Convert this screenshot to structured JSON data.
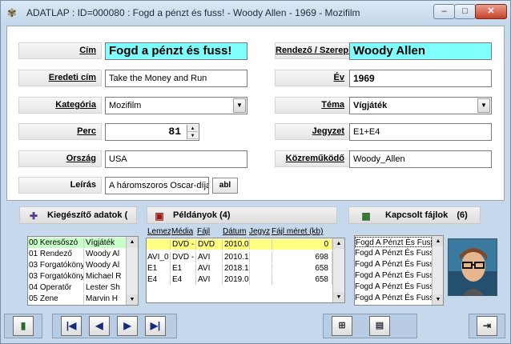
{
  "window": {
    "title": "ADATLAP : ID=000080 : Fogd a pénzt és fuss! - Woody Allen - 1969 - Mozifilm",
    "min_glyph": "–",
    "max_glyph": "□",
    "close_glyph": "✕"
  },
  "fields": {
    "cim": {
      "label": "Cím",
      "value": "Fogd a pénzt és fuss!"
    },
    "rendezo": {
      "label": "Rendező / Szereplő",
      "value": "Woody Allen"
    },
    "eredeti_cim": {
      "label": "Eredeti cím",
      "value": "Take the Money and Run"
    },
    "ev": {
      "label": "Év",
      "value": "1969"
    },
    "kategoria": {
      "label": "Kategória",
      "value": "Mozifilm"
    },
    "tema": {
      "label": "Téma",
      "value": "Vígjáték"
    },
    "perc": {
      "label": "Perc",
      "value": "81"
    },
    "jegyzet": {
      "label": "Jegyzet",
      "value": "E1+E4"
    },
    "orszag": {
      "label": "Ország",
      "value": "USA"
    },
    "kozremukodo": {
      "label": "Közreműködő",
      "value": "Woody_Allen"
    },
    "leiras": {
      "label": "Leírás",
      "value": "A háromszoros Oscar-díja",
      "abl_label": "abl"
    }
  },
  "kiegeszito": {
    "header": "Kiegészítő adatok (",
    "rows": [
      {
        "key": "00 Keresőszó",
        "value": "Vígjáték"
      },
      {
        "key": "01 Rendező",
        "value": "Woody Al"
      },
      {
        "key": "03 Forgatókönyv",
        "value": "Woody Al"
      },
      {
        "key": "03 Forgatókönyv",
        "value": "Michael R"
      },
      {
        "key": "04 Operatőr",
        "value": "Lester Sh"
      },
      {
        "key": "05 Zene",
        "value": "Marvin H"
      }
    ]
  },
  "peldanyok": {
    "header": "Példányok (4)",
    "columns": [
      "Lemez",
      "Média",
      "Fájl",
      "Dátum",
      "Jegyz",
      "Fájl méret (kb)"
    ],
    "rows": [
      {
        "lemez": "",
        "media": "DVD -",
        "fajl": "DVD",
        "datum": "2010.0",
        "jegyz": "",
        "meret": "0"
      },
      {
        "lemez": "AVI_0",
        "media": "DVD -",
        "fajl": "AVI",
        "datum": "2010.1",
        "jegyz": "",
        "meret": "698"
      },
      {
        "lemez": "E1",
        "media": "E1",
        "fajl": "AVI",
        "datum": "2018.1",
        "jegyz": "",
        "meret": "658"
      },
      {
        "lemez": "E4",
        "media": "E4",
        "fajl": "AVI",
        "datum": "2019.0",
        "jegyz": "",
        "meret": "658"
      }
    ]
  },
  "kapcsolt": {
    "header": "Kapcsolt fájlok",
    "count": "(6)",
    "rows": [
      "Fogd A Pénzt És Fuss",
      "Fogd A Pénzt És Fuss",
      "Fogd A Pénzt És Fuss",
      "Fogd A Pénzt És Fuss",
      "Fogd A Pénzt És Fuss",
      "Fogd A Pénzt És Fuss"
    ]
  },
  "icons": {
    "app": "film-reel-icon",
    "kiegeszito": "puzzle-icon",
    "peldanyok": "film-icon",
    "kapcsolt": "image-icon",
    "delete": "trash-icon",
    "first": "first-record-icon",
    "prev": "prev-record-icon",
    "next": "next-record-icon",
    "last": "last-record-icon",
    "new_doc": "new-document-icon",
    "print": "print-icon",
    "exit": "exit-icon"
  },
  "colors": {
    "highlight_field": "#80ffff",
    "selected_row": "#ffff80",
    "selected_item": "#c8ffc8",
    "window_bg": "#c5d8ec"
  }
}
